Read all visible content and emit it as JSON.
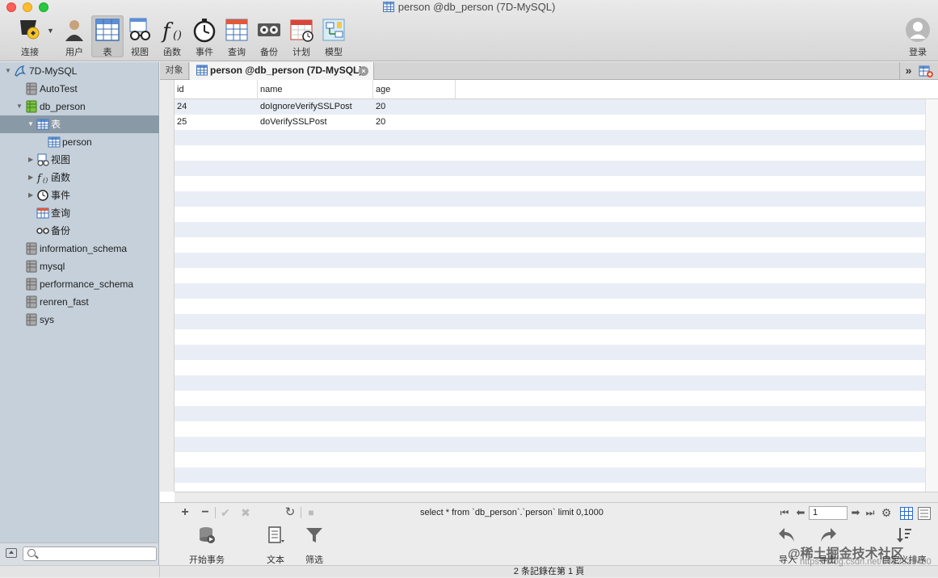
{
  "window": {
    "title": "person @db_person (7D-MySQL)"
  },
  "toolbar": {
    "items": [
      {
        "label": "连接",
        "icon": "connection-icon"
      },
      {
        "label": "用户",
        "icon": "user-icon"
      },
      {
        "label": "表",
        "icon": "table-icon",
        "active": true
      },
      {
        "label": "视图",
        "icon": "view-glasses-icon"
      },
      {
        "label": "函数",
        "icon": "function-icon"
      },
      {
        "label": "事件",
        "icon": "event-clock-icon"
      },
      {
        "label": "查询",
        "icon": "query-icon"
      },
      {
        "label": "备份",
        "icon": "backup-tape-icon"
      },
      {
        "label": "计划",
        "icon": "schedule-calendar-icon"
      },
      {
        "label": "模型",
        "icon": "model-icon"
      }
    ],
    "login_label": "登录"
  },
  "sidebar": {
    "tree": [
      {
        "label": "7D-MySQL",
        "icon": "dolphin-connection-icon",
        "expanded": true
      },
      {
        "label": "AutoTest",
        "icon": "database-icon"
      },
      {
        "label": "db_person",
        "icon": "database-open-icon",
        "expanded": true
      },
      {
        "label": "表",
        "icon": "table-folder-icon",
        "expanded": true,
        "selected": true
      },
      {
        "label": "person",
        "icon": "table-icon"
      },
      {
        "label": "视图",
        "icon": "view-glasses-icon"
      },
      {
        "label": "函数",
        "icon": "function-icon"
      },
      {
        "label": "事件",
        "icon": "event-clock-icon"
      },
      {
        "label": "查询",
        "icon": "query-icon"
      },
      {
        "label": "备份",
        "icon": "backup-tape-icon"
      },
      {
        "label": "information_schema",
        "icon": "database-icon"
      },
      {
        "label": "mysql",
        "icon": "database-icon"
      },
      {
        "label": "performance_schema",
        "icon": "database-icon"
      },
      {
        "label": "renren_fast",
        "icon": "database-icon"
      },
      {
        "label": "sys",
        "icon": "database-icon"
      }
    ],
    "search_placeholder": ""
  },
  "tabs": {
    "objects_label": "对象",
    "active_label": "person @db_person (7D-MySQL)"
  },
  "grid": {
    "columns": [
      "id",
      "name",
      "age"
    ],
    "rows": [
      [
        "24",
        "doIgnoreVerifySSLPost",
        "20"
      ],
      [
        "25",
        "doVerifySSLPost",
        "20"
      ]
    ]
  },
  "editor": {
    "sql": "select * from `db_person`.`person` limit 0,1000",
    "page_value": "1"
  },
  "actions": {
    "begin_transaction": "开始事务",
    "text": "文本",
    "filter": "筛选",
    "import": "导入",
    "export": "导出",
    "sort": "自定义排序"
  },
  "status": {
    "text": "2 条記錄在第 1 頁"
  },
  "watermark": {
    "text": "@稀土掘金技术社区",
    "url": "https://blog.csdn.net/u012523460"
  }
}
